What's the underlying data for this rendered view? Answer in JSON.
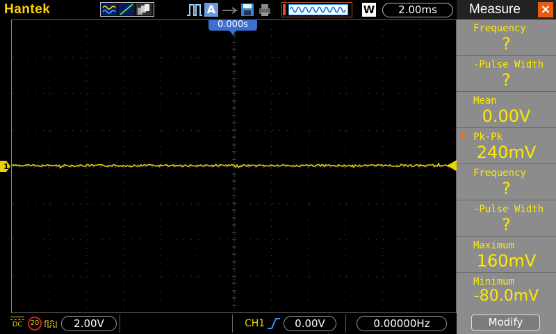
{
  "header": {
    "brand": "Hantek",
    "timebase": "2.00ms",
    "trigger_position": "0.000s",
    "mode_letter": "A",
    "acq_letter": "W"
  },
  "channel": {
    "marker": "1",
    "coupling": "DC",
    "bandwidth_limit": "20",
    "volts_per_div": "2.00V",
    "color": "#e8d400"
  },
  "trigger": {
    "source": "CH1",
    "level": "0.00V",
    "frequency": "0.00000Hz"
  },
  "measure": {
    "title": "Measure",
    "close_icon": "×",
    "items": [
      {
        "label": "Frequency",
        "value": "?"
      },
      {
        "label": "-Pulse Width",
        "value": "?"
      },
      {
        "label": "Mean",
        "value": "0.00V"
      },
      {
        "label": "Pk-Pk",
        "value": "240mV"
      },
      {
        "label": "Frequency",
        "value": "?"
      },
      {
        "label": "-Pulse Width",
        "value": "?"
      },
      {
        "label": "Maximum",
        "value": "160mV"
      },
      {
        "label": "Minimum",
        "value": "-80.0mV"
      }
    ],
    "modify_label": "Modify"
  }
}
